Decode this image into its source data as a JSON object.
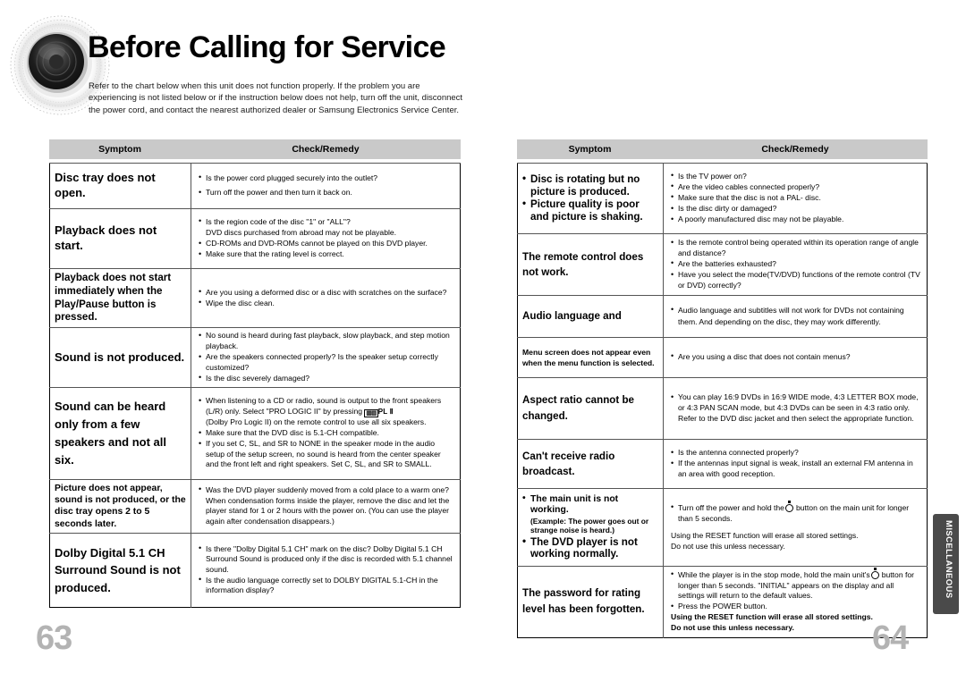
{
  "header": {
    "title": "Before Calling for Service",
    "intro": "Refer to the chart below when this unit does not function properly. If the problem you are experiencing is not listed below or if the instruction below does not help, turn off the unit, disconnect the power cord, and contact the nearest authorized dealer or Samsung Electronics Service Center.",
    "logo_icon": "speaker-woofer-icon"
  },
  "table_headers": {
    "symptom": "Symptom",
    "remedy": "Check/Remedy"
  },
  "left_table": {
    "rows": [
      {
        "symptom": "Disc tray does not open.",
        "remedy": [
          "Is the power cord plugged securely into the outlet?",
          "Turn off the power and then turn it back on."
        ]
      },
      {
        "symptom": "Playback does not start.",
        "remedy": [
          "Is the region code of the disc \"1\" or \"ALL\"?",
          "DVD discs purchased from abroad may not be playable.",
          "CD-ROMs and DVD-ROMs cannot be played on this DVD player.",
          "Make sure that the rating level is correct."
        ]
      },
      {
        "symptom": "Playback does not start immediately when the Play/Pause button is pressed.",
        "remedy": [
          "Are you using a deformed disc or a disc with scratches on the surface?",
          "Wipe the disc clean."
        ]
      },
      {
        "symptom": "Sound is not produced.",
        "remedy": [
          "No sound is heard during fast playback, slow playback, and step motion playback.",
          "Are the speakers connected properly? Is the speaker setup correctly customized?",
          "Is the disc severely damaged?"
        ]
      },
      {
        "symptom": "Sound can be heard only from a few speakers and not all six.",
        "remedy": [
          "When listening to a CD or radio, sound is output to the front speakers (L/R) only. Select \"PRO LOGIC II\" by pressing",
          "(Dolby Pro Logic II) on the remote control to use all six speakers.",
          "Make sure that the DVD disc is 5.1-CH compatible.",
          "If you set C, SL, and SR to NONE in the speaker mode in the audio setup of the setup screen, no sound is heard from the center speaker and the front left and right speakers. Set C, SL, and SR to SMALL."
        ],
        "inline_mark": "PL Ⅱ"
      },
      {
        "symptom": "Picture does not appear, sound is not produced, or the disc tray opens 2 to 5 seconds later.",
        "remedy": [
          "Was the DVD player suddenly moved from a cold place to a warm one? When condensation forms inside the player, remove the disc and let the player stand for 1 or 2 hours with the power on. (You can use the player again after condensation disappears.)"
        ]
      },
      {
        "symptom": "Dolby Digital 5.1 CH Surround Sound is not produced.",
        "remedy": [
          "Is there \"Dolby Digital 5.1 CH\" mark on the disc? Dolby Digital 5.1 CH Surround Sound is produced only if the disc is recorded with 5.1 channel sound.",
          "Is the audio language correctly set to DOLBY DIGITAL 5.1-CH in the information display?"
        ]
      }
    ]
  },
  "right_table": {
    "rows": [
      {
        "symptom_bullets": [
          "Disc is rotating but no picture is produced.",
          "Picture quality is poor and picture is shaking."
        ],
        "remedy": [
          "Is the TV power on?",
          "Are the video cables connected properly?",
          "Make sure that the disc is not a PAL- disc.",
          "Is the disc dirty or damaged?",
          "A poorly manufactured disc may not be playable."
        ]
      },
      {
        "symptom": "The remote control does not work.",
        "remedy": [
          "Is the remote control being operated within its operation range of angle and distance?",
          "Are the batteries exhausted?",
          "Have you select the mode(TV/DVD) functions of the remote control (TV or DVD) correctly?"
        ]
      },
      {
        "symptom": "Audio language and",
        "remedy": [
          "Audio language and subtitles will not work for DVDs not containing them. And depending on the disc, they may work differently."
        ]
      },
      {
        "symptom": "Menu screen does not appear even when the menu function is selected.",
        "remedy": [
          "Are you using a disc that does not contain menus?"
        ]
      },
      {
        "symptom": "Aspect ratio cannot be changed.",
        "remedy": [
          "You can play 16:9 DVDs in 16:9 WIDE mode, 4:3 LETTER BOX mode, or 4:3 PAN SCAN mode, but 4:3 DVDs can be seen in 4:3 ratio only. Refer to the DVD disc jacket and then select the appropriate function."
        ]
      },
      {
        "symptom": "Can't receive radio broadcast.",
        "remedy": [
          "Is the antenna connected properly?",
          "If the antennas input signal is weak, install an external FM antenna in an area with good reception."
        ]
      },
      {
        "symptom_bullets": [
          "The main unit is not working.",
          "The DVD player is not working normally."
        ],
        "symptom_sub": "(Example: The power goes out or strange noise is heard.)",
        "remedy_pre": "Turn off the power and hold the",
        "remedy_post": "button on the main unit for longer than 5 seconds.",
        "remedy_note": [
          "Using the RESET function will erase all stored settings.",
          "Do not use this unless necessary."
        ]
      },
      {
        "symptom": "The password for rating level has been forgotten.",
        "remedy_pre": "While the player is in the stop mode, hold the main unit's",
        "remedy_post": "button for longer than 5 seconds. \"INITIAL\" appears on the display and all settings will return to the default values.",
        "remedy_extra": "Press the POWER button.",
        "remedy_note": [
          "Using the RESET function will erase all stored settings.",
          "Do not use this unless necessary."
        ]
      }
    ]
  },
  "folio": {
    "left": "63",
    "right": "64"
  },
  "side_tab": {
    "label": "MISCELLANEOUS"
  }
}
